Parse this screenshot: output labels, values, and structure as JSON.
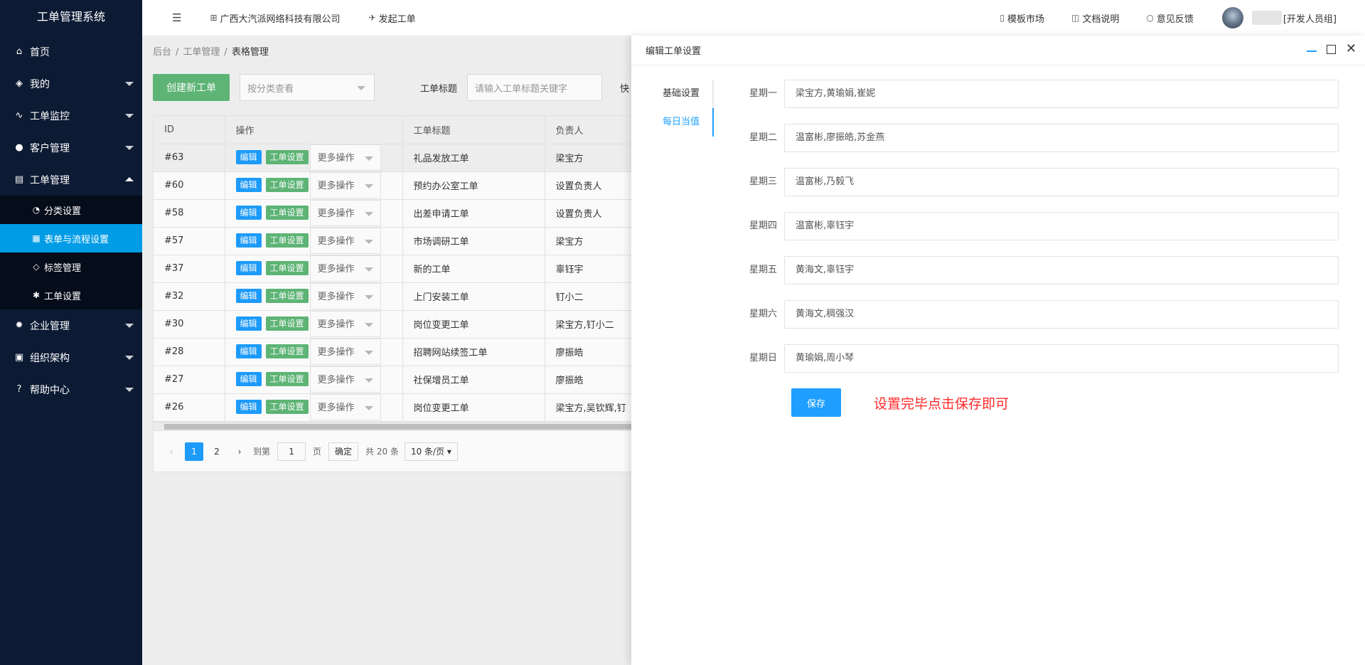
{
  "sidebar": {
    "brand": "工单管理系统",
    "items": [
      {
        "label": "首页",
        "icon": "home-icon"
      },
      {
        "label": "我的",
        "icon": "layers-icon"
      },
      {
        "label": "工单监控",
        "icon": "pulse-icon"
      },
      {
        "label": "客户管理",
        "icon": "users-icon"
      },
      {
        "label": "工单管理",
        "icon": "clipboard-icon"
      },
      {
        "label": "企业管理",
        "icon": "gear-icon"
      },
      {
        "label": "组织架构",
        "icon": "org-icon"
      },
      {
        "label": "帮助中心",
        "icon": "question-icon"
      }
    ],
    "sub_items": [
      {
        "label": "分类设置"
      },
      {
        "label": "表单与流程设置"
      },
      {
        "label": "标签管理"
      },
      {
        "label": "工单设置"
      }
    ]
  },
  "topbar": {
    "company": "广西大汽派网络科技有限公司",
    "launch": "发起工单",
    "template_market": "模板市场",
    "docs": "文档说明",
    "feedback": "意见反馈",
    "user_group": "[开发人员组]"
  },
  "breadcrumb": {
    "root": "后台",
    "mid": "工单管理",
    "current": "表格管理",
    "sep": "/"
  },
  "toolbar": {
    "create_label": "创建新工单",
    "category_placeholder": "按分类查看",
    "title_label": "工单标题",
    "title_placeholder": "请输入工单标题关键字",
    "quick_label": "快"
  },
  "table": {
    "headers": [
      "ID",
      "操作",
      "工单标题",
      "负责人"
    ],
    "edit_label": "编辑",
    "settings_label": "工单设置",
    "more_label": "更多操作",
    "rows": [
      {
        "id": "#63",
        "title": "礼品发放工单",
        "owner": "梁宝方"
      },
      {
        "id": "#60",
        "title": "预约办公室工单",
        "owner": "设置负责人"
      },
      {
        "id": "#58",
        "title": "出差申请工单",
        "owner": "设置负责人"
      },
      {
        "id": "#57",
        "title": "市场调研工单",
        "owner": "梁宝方"
      },
      {
        "id": "#37",
        "title": "新的工单",
        "owner": "辜钰宇"
      },
      {
        "id": "#32",
        "title": "上门安装工单",
        "owner": "钉小二"
      },
      {
        "id": "#30",
        "title": "岗位变更工单",
        "owner": "梁宝方,钉小二"
      },
      {
        "id": "#28",
        "title": "招聘网站续签工单",
        "owner": "廖振皓"
      },
      {
        "id": "#27",
        "title": "社保增员工单",
        "owner": "廖振皓"
      },
      {
        "id": "#26",
        "title": "岗位变更工单",
        "owner": "梁宝方,吴钦辉,钉"
      }
    ]
  },
  "pager": {
    "pages": [
      "1",
      "2"
    ],
    "goto": "到第",
    "page_value": "1",
    "page_unit": "页",
    "confirm": "确定",
    "total": "共 20 条",
    "size": "10 条/页"
  },
  "drawer": {
    "title": "编辑工单设置",
    "tabs": [
      "基础设置",
      "每日当值"
    ],
    "days": [
      {
        "label": "星期一",
        "value": "梁宝方,黄瑜娟,崔妮"
      },
      {
        "label": "星期二",
        "value": "温富彬,廖振皓,苏金燕"
      },
      {
        "label": "星期三",
        "value": "温富彬,乃毅飞"
      },
      {
        "label": "星期四",
        "value": "温富彬,辜钰宇"
      },
      {
        "label": "星期五",
        "value": "黄海文,辜钰宇"
      },
      {
        "label": "星期六",
        "value": "黄海文,稠强汉"
      },
      {
        "label": "星期日",
        "value": "黄瑜娟,周小琴"
      }
    ],
    "save_label": "保存",
    "tip": "设置完毕点击保存即可"
  },
  "colors": {
    "sidebar_bg": "#0c1a33",
    "active_blue": "#009ce6",
    "primary": "#1e9fff",
    "green": "#5fb878",
    "tip_red": "#ff2a2a"
  }
}
